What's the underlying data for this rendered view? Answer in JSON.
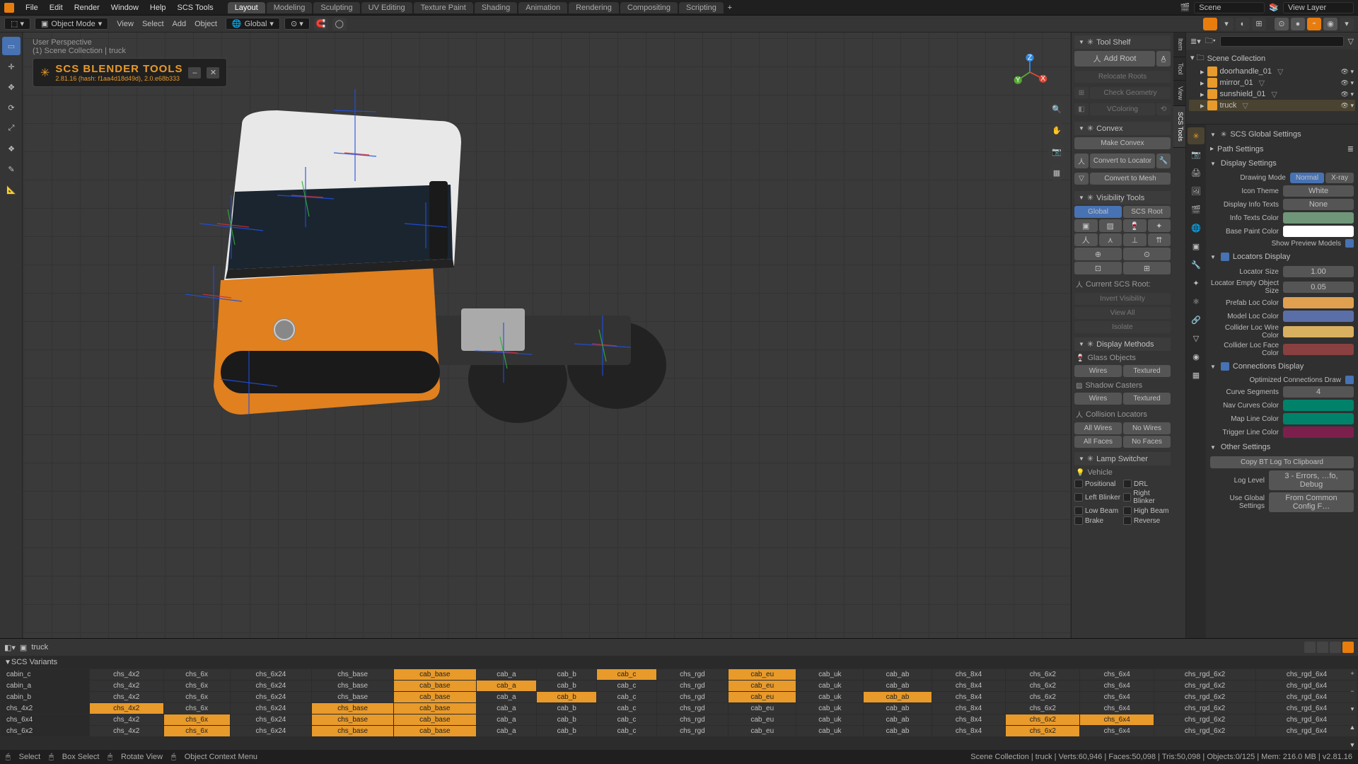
{
  "topbar": {
    "menus": [
      "File",
      "Edit",
      "Render",
      "Window",
      "Help",
      "SCS Tools"
    ],
    "tabs": [
      "Layout",
      "Modeling",
      "Sculpting",
      "UV Editing",
      "Texture Paint",
      "Shading",
      "Animation",
      "Rendering",
      "Compositing",
      "Scripting"
    ],
    "active_tab": 0,
    "scene": "Scene",
    "viewlayer": "View Layer"
  },
  "toolbar2": {
    "mode": "Object Mode",
    "menus": [
      "View",
      "Select",
      "Add",
      "Object"
    ],
    "orientation": "Global"
  },
  "viewport": {
    "perspective": "User Perspective",
    "collection": "(1) Scene Collection | truck",
    "scs_title": "SCS BLENDER TOOLS",
    "scs_ver": "2.81.16 (hash: f1aa4d18d49d), 2.0.e68b333"
  },
  "tool_shelf": {
    "title": "Tool Shelf",
    "add_root": "Add Root",
    "relocate": "Relocate Roots",
    "check_geom": "Check Geometry",
    "vcoloring": "VColoring"
  },
  "convex": {
    "title": "Convex",
    "make": "Make Convex",
    "to_loc": "Convert to Locator",
    "to_mesh": "Convert to Mesh"
  },
  "vis_tools": {
    "title": "Visibility Tools",
    "global": "Global",
    "scs_root": "SCS Root",
    "current": "Current SCS Root:",
    "invert": "Invert Visibility",
    "viewall": "View All",
    "isolate": "Isolate"
  },
  "disp_methods": {
    "title": "Display Methods",
    "glass": "Glass Objects",
    "shadow": "Shadow Casters",
    "collision": "Collision Locators",
    "wires": "Wires",
    "textured": "Textured",
    "all_wires": "All Wires",
    "no_wires": "No Wires",
    "all_faces": "All Faces",
    "no_faces": "No Faces"
  },
  "lamp_switcher": {
    "title": "Lamp Switcher",
    "vehicle": "Vehicle",
    "opts": [
      "Positional",
      "DRL",
      "Left Blinker",
      "Right Blinker",
      "Low Beam",
      "High Beam",
      "Brake",
      "Reverse"
    ]
  },
  "outliner": {
    "root": "Scene Collection",
    "items": [
      "doorhandle_01",
      "mirror_01",
      "sunshield_01",
      "truck"
    ],
    "selected": 3
  },
  "props": {
    "title": "SCS Global Settings",
    "path": "Path Settings",
    "display": "Display Settings",
    "drawing_mode": "Drawing Mode",
    "drawing_opts": [
      "Normal",
      "X-ray"
    ],
    "drawing_active": 0,
    "icon_theme_lbl": "Icon Theme",
    "icon_theme": "White",
    "info_texts_lbl": "Display Info Texts",
    "info_texts": "None",
    "info_color_lbl": "Info Texts Color",
    "info_color": "#6f9678",
    "paint_color_lbl": "Base Paint Color",
    "paint_color": "#ffffff",
    "preview_models": "Show Preview Models",
    "loc_display": "Locators Display",
    "loc_size_lbl": "Locator Size",
    "loc_size": "1.00",
    "loc_empty_lbl": "Locator Empty Object Size",
    "loc_empty": "0.05",
    "prefab_color_lbl": "Prefab Loc Color",
    "prefab_color": "#e0a050",
    "model_color_lbl": "Model Loc Color",
    "model_color": "#5a6fa8",
    "coll_wire_lbl": "Collider Loc Wire Color",
    "coll_wire": "#d8b060",
    "coll_face_lbl": "Collider Loc Face Color",
    "coll_face": "#8a4040",
    "conn_display": "Connections Display",
    "conn_opt": "Optimized Connections Draw",
    "curve_seg_lbl": "Curve Segments",
    "curve_seg": "4",
    "nav_color_lbl": "Nav Curves Color",
    "nav_color": "#00826a",
    "map_color_lbl": "Map Line Color",
    "map_color": "#00826a",
    "trig_color_lbl": "Trigger Line Color",
    "trig_color": "#7d1f4d",
    "other": "Other Settings",
    "copy_log": "Copy BT Log To Clipboard",
    "log_lvl_lbl": "Log Level",
    "log_lvl": "3 - Errors, …fo, Debug",
    "use_global_lbl": "Use Global Settings",
    "use_global": "From Common Config F…"
  },
  "variants": {
    "title": "SCS Variants",
    "object": "truck",
    "rows": [
      "cabin_c",
      "cabin_a",
      "cabin_b",
      "chs_4x2",
      "chs_6x4",
      "chs_6x2"
    ],
    "cols": [
      "chs_4x2",
      "chs_6x",
      "chs_6x24",
      "chs_base",
      "cab_base",
      "cab_a",
      "cab_b",
      "cab_c",
      "chs_rgd",
      "cab_eu",
      "cab_uk",
      "cab_ab",
      "chs_8x4",
      "chs_6x2",
      "chs_6x4",
      "chs_rgd_6x2",
      "chs_rgd_6x4"
    ],
    "on": {
      "0": [
        4,
        7,
        9
      ],
      "1": [
        4,
        5,
        9
      ],
      "2": [
        4,
        6,
        9,
        11
      ],
      "3": [
        0,
        3,
        4
      ],
      "4": [
        1,
        3,
        4,
        13,
        14
      ],
      "5": [
        1,
        3,
        4,
        13
      ]
    }
  },
  "status": {
    "select": "Select",
    "box": "Box Select",
    "rotate": "Rotate View",
    "ctx": "Object Context Menu",
    "right": "Scene Collection | truck | Verts:60,946 | Faces:50,098 | Tris:50,098 | Objects:0/125 | Mem: 216.0 MB | v2.81.16"
  }
}
